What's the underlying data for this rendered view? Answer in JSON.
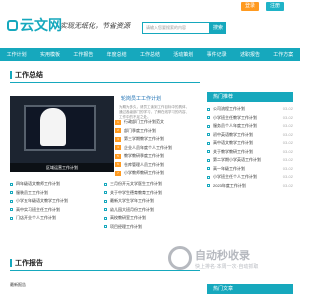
{
  "topbar": {
    "login": "登录",
    "register": "注册"
  },
  "header": {
    "logo": "云文网",
    "slogan": "实现无纸化，节省资源",
    "search_placeholder": "请输入您要搜索的内容",
    "search_button": "搜索"
  },
  "nav": [
    "工作计划",
    "实用模板",
    "工作报告",
    "年度总结",
    "工作总结",
    "活动策划",
    "事件记录",
    "述职报告",
    "工作方案"
  ],
  "section1": {
    "title": "工作总结"
  },
  "feature": {
    "caption": "区域运营工作计划",
    "headline": "轮岗员工工作计划",
    "summary": "为期为多久，请员工读到工作目标中的具体，通过各级部门的学习，了解在线学习的内容、工作中的不足之处。"
  },
  "middle_list": [
    {
      "num": "1",
      "text": "行政部门工作计划范文",
      "date": "2024-05"
    },
    {
      "num": "2",
      "text": "部门季度工作计划",
      "date": "2024-05"
    },
    {
      "num": "3",
      "text": "第三学期教学工作计划",
      "date": "2024-05"
    },
    {
      "num": "4",
      "text": "企业人员年度个人工作计划",
      "date": "2024-05"
    },
    {
      "num": "5",
      "text": "教学教研季度工作计划",
      "date": "2024-05"
    },
    {
      "num": "6",
      "text": "仓库管理人员工作计划",
      "date": "2024-05"
    },
    {
      "num": "7",
      "text": "小学教师教研工作计划",
      "date": "2024-05"
    }
  ],
  "left_list": [
    {
      "text": "四年级语文教师工作计划"
    },
    {
      "text": "服装员工工作计划"
    },
    {
      "text": "小学五年级语文教学工作计划"
    },
    {
      "text": "高中实习班主任工作计划"
    },
    {
      "text": "门店开业个人工作计划"
    }
  ],
  "middle_list2": [
    {
      "text": "三月份开元文学医生工作计划"
    },
    {
      "text": "关于中学生德育教育工作计划"
    },
    {
      "text": "最新大学生学年工作计划"
    },
    {
      "text": "幼儿园大班月份工作计划"
    },
    {
      "text": "高校教研室工作计划"
    },
    {
      "text": "项目经理工作计划"
    }
  ],
  "sidebar": {
    "title": "热门推荐",
    "items": [
      {
        "text": "公司流程工作计划",
        "date": "03-02"
      },
      {
        "text": "小学班主任教学工作计划",
        "date": "03-02"
      },
      {
        "text": "服务员个人年度工作计划",
        "date": "03-02"
      },
      {
        "text": "初中英语教学工作计划",
        "date": "03-02"
      },
      {
        "text": "高中语文教学工作计划",
        "date": "03-02"
      },
      {
        "text": "关于教学教研工作计划",
        "date": "03-02"
      },
      {
        "text": "第二学期小学英语工作计划",
        "date": "03-02"
      },
      {
        "text": "高一年级工作计划",
        "date": "03-02"
      },
      {
        "text": "小学班主任个人工作计划",
        "date": "03-02"
      },
      {
        "text": "2023年度工作计划",
        "date": "03-02"
      }
    ],
    "footer": "热门文章"
  },
  "section2": {
    "title": "工作报告",
    "tag": "最新报告"
  },
  "watermark": {
    "title": "自动秒收录",
    "subtitle": "快上排名·本周一次·自动抓取"
  },
  "colors": {
    "accent": "#16a8bd",
    "orange": "#ff9a1f"
  }
}
